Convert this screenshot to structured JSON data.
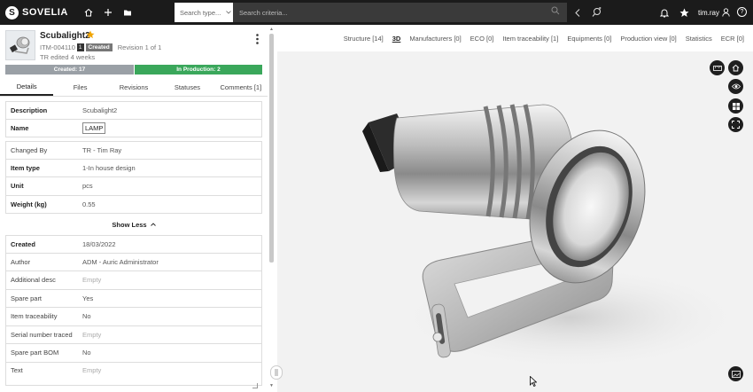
{
  "header": {
    "logo_mark": "S",
    "logo_text": "SOVELIA",
    "search_type": "Search type...",
    "search_placeholder": "Search criteria...",
    "username": "tim.ray"
  },
  "item": {
    "title": "Scubalight2",
    "code": "ITM-004110",
    "version": "1",
    "state": "Created",
    "revision": "Revision 1 of 1",
    "edited": "TR edited 4 weeks"
  },
  "status_bar": {
    "created": "Created: 17",
    "in_production": "In Production: 2"
  },
  "tabs": [
    "Details",
    "Files",
    "Revisions",
    "Statuses",
    "Comments [1]"
  ],
  "group1": [
    {
      "label": "Description",
      "value": "Scubalight2",
      "bold": true
    },
    {
      "label": "Name",
      "value": "LAMP",
      "bold": true,
      "boxed": true
    }
  ],
  "group2": [
    {
      "label": "Changed By",
      "value": "TR - Tim Ray"
    },
    {
      "label": "Item type",
      "value": "1-In house design",
      "bold": true
    },
    {
      "label": "Unit",
      "value": "pcs",
      "bold": true
    },
    {
      "label": "Weight (kg)",
      "value": "0.55",
      "bold": true
    }
  ],
  "show_less": "Show Less",
  "group3": [
    {
      "label": "Created",
      "value": "18/03/2022",
      "bold": true
    },
    {
      "label": "Author",
      "value": "ADM - Auric Administrator"
    },
    {
      "label": "Additional desc",
      "value": "Empty",
      "empty": true
    },
    {
      "label": "Spare part",
      "value": "Yes"
    },
    {
      "label": "Item traceability",
      "value": "No"
    },
    {
      "label": "Serial number traced",
      "value": "Empty",
      "empty": true
    },
    {
      "label": "Spare part BOM",
      "value": "No"
    },
    {
      "label": "Text",
      "value": "Empty",
      "empty": true
    }
  ],
  "viewer_tabs": [
    {
      "label": "Structure [14]",
      "active": false
    },
    {
      "label": "3D",
      "active": true
    },
    {
      "label": "Manufacturers [0]",
      "active": false
    },
    {
      "label": "ECO [0]",
      "active": false
    },
    {
      "label": "Item traceability [1]",
      "active": false
    },
    {
      "label": "Equipments [0]",
      "active": false
    },
    {
      "label": "Production view [0]",
      "active": false
    },
    {
      "label": "Statistics",
      "active": false
    },
    {
      "label": "ECR [0]",
      "active": false
    }
  ],
  "viewer_buttons": [
    "measure-icon",
    "home-icon",
    "eye-icon",
    "grid-icon",
    "fullscreen-icon",
    "snapshot-icon"
  ],
  "colors": {
    "topbar": "#1b1b1b",
    "created_status": "#9aa0a6",
    "production_status": "#3aa75b",
    "favorite": "#f0a400"
  }
}
